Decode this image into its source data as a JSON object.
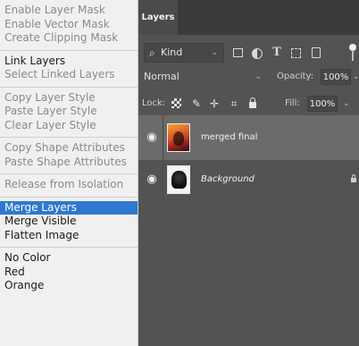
{
  "menu": {
    "groups": [
      [
        {
          "label": "Enable Layer Mask",
          "state": "disabled"
        },
        {
          "label": "Enable Vector Mask",
          "state": "disabled"
        },
        {
          "label": "Create Clipping Mask",
          "state": "disabled"
        }
      ],
      [
        {
          "label": "Link Layers",
          "state": "enabled"
        },
        {
          "label": "Select Linked Layers",
          "state": "disabled"
        }
      ],
      [
        {
          "label": "Copy Layer Style",
          "state": "disabled"
        },
        {
          "label": "Paste Layer Style",
          "state": "disabled"
        },
        {
          "label": "Clear Layer Style",
          "state": "disabled"
        }
      ],
      [
        {
          "label": "Copy Shape Attributes",
          "state": "disabled"
        },
        {
          "label": "Paste Shape Attributes",
          "state": "disabled"
        }
      ],
      [
        {
          "label": "Release from Isolation",
          "state": "disabled"
        }
      ],
      [
        {
          "label": "Merge Layers",
          "state": "selected"
        },
        {
          "label": "Merge Visible",
          "state": "enabled"
        },
        {
          "label": "Flatten Image",
          "state": "enabled"
        }
      ],
      [
        {
          "label": "No Color",
          "state": "enabled"
        },
        {
          "label": "Red",
          "state": "enabled"
        },
        {
          "label": "Orange",
          "state": "enabled"
        }
      ]
    ]
  },
  "panel": {
    "tab_label": "Layers",
    "filter": {
      "kind_label": "Kind",
      "icons": [
        "image-filter-icon",
        "adjustment-filter-icon",
        "type-filter-icon",
        "shape-filter-icon",
        "smart-object-filter-icon"
      ]
    },
    "blend_mode": "Normal",
    "opacity_label": "Opacity:",
    "opacity_value": "100%",
    "lock_label": "Lock:",
    "fill_label": "Fill:",
    "fill_value": "100%",
    "layers": [
      {
        "name": "merged final",
        "visible": true,
        "selected": true
      },
      {
        "name": "Background",
        "visible": true,
        "selected": false,
        "locked": true
      }
    ]
  },
  "colors": {
    "menu_bg": "#f0f0f0",
    "menu_highlight": "#2f78cf",
    "panel_bg": "#535353",
    "selected_layer_bg": "#6b6b6b"
  }
}
